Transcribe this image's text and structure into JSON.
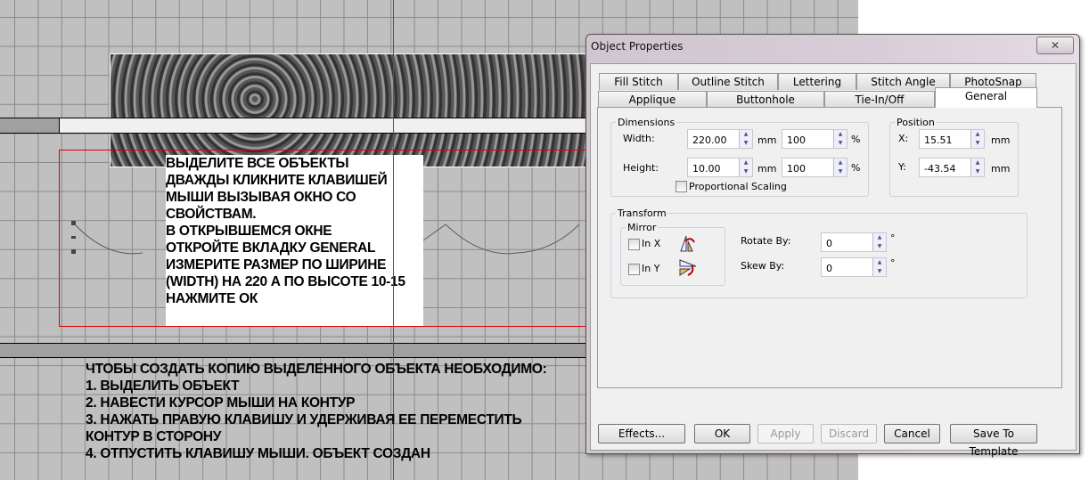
{
  "canvas": {
    "note1": "ВЫДЕЛИТЕ ВСЕ ОБЪЕКТЫ\nДВАЖДЫ КЛИКНИТЕ КЛАВИШЕЙ\nМЫШИ ВЫЗЫВАЯ ОКНО СО\nСВОЙСТВАМ.\nВ ОТКРЫВШЕМСЯ ОКНЕ\nОТКРОЙТЕ ВКЛАДКУ GENERAL\nИЗМЕРИТЕ РАЗМЕР ПО ШИРИНЕ\n(WIDTH) НА 220 А ПО ВЫСОТЕ 10-15\nНАЖМИТЕ ОК",
    "note2": "ЧТОБЫ СОЗДАТЬ КОПИЮ ВЫДЕЛЕННОГО ОБЪЕКТА НЕОБХОДИМО:\n1. ВЫДЕЛИТЬ ОБЪЕКТ\n2. НАВЕСТИ КУРСОР МЫШИ НА КОНТУР\n3. НАЖАТЬ ПРАВУЮ КЛАВИШУ И УДЕРЖИВАЯ ЕЕ ПЕРЕМЕСТИТЬ\nКОНТУР В СТОРОНУ\n4. ОТПУСТИТЬ КЛАВИШУ МЫШИ. ОБЪЕКТ СОЗДАН"
  },
  "dialog": {
    "title": "Object Properties",
    "close_icon": "close-icon",
    "tabs_row1": [
      "Fill Stitch",
      "Outline Stitch",
      "Lettering",
      "Stitch Angle",
      "PhotoSnap"
    ],
    "tabs_row2": [
      "Applique",
      "Buttonhole",
      "Tie-In/Off",
      "General"
    ],
    "dimensions": {
      "legend": "Dimensions",
      "width_label": "Width:",
      "width": "220.00",
      "width_pct": "100",
      "height_label": "Height:",
      "height": "10.00",
      "height_pct": "100",
      "unit": "mm",
      "pct": "%",
      "proportional": "Proportional Scaling"
    },
    "position": {
      "legend": "Position",
      "x_label": "X:",
      "x": "15.51",
      "y_label": "Y:",
      "y": "-43.54",
      "unit": "mm"
    },
    "transform": {
      "legend": "Transform",
      "mirror": "Mirror",
      "in_x": "In X",
      "in_y": "In Y",
      "rotate_label": "Rotate By:",
      "rotate": "0",
      "skew_label": "Skew By:",
      "skew": "0",
      "deg": "°"
    },
    "buttons": {
      "effects": "Effects...",
      "ok": "OK",
      "apply": "Apply",
      "discard": "Discard",
      "cancel": "Cancel",
      "save": "Save To Template"
    }
  }
}
